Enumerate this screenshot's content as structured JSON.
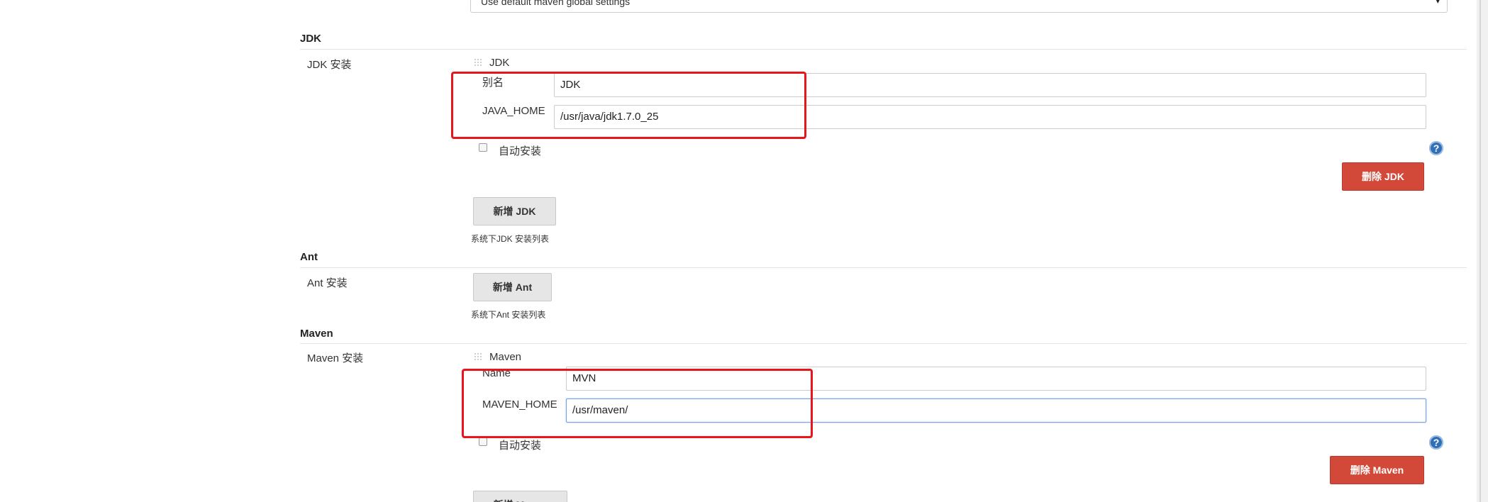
{
  "top_select": {
    "value": "Use default maven global settings"
  },
  "jdk": {
    "section_title": "JDK",
    "row_label": "JDK 安装",
    "item_title": "JDK",
    "alias_label": "别名",
    "alias_value": "JDK",
    "home_label": "JAVA_HOME",
    "home_value": "/usr/java/jdk1.7.0_25",
    "auto_install_label": "自动安装",
    "delete_button": "删除 JDK",
    "add_button": "新增 JDK",
    "hint": "系统下JDK 安装列表"
  },
  "ant": {
    "section_title": "Ant",
    "row_label": "Ant 安装",
    "add_button": "新增 Ant",
    "hint": "系统下Ant 安装列表"
  },
  "maven": {
    "section_title": "Maven",
    "row_label": "Maven 安装",
    "item_title": "Maven",
    "name_label": "Name",
    "name_value": "MVN",
    "home_label": "MAVEN_HOME",
    "home_value": "/usr/maven/",
    "auto_install_label": "自动安装",
    "delete_button": "删除 Maven",
    "add_button": "新增 Maven"
  },
  "icons": {
    "help": "?",
    "caret": "▾"
  },
  "colors": {
    "danger": "#d24939",
    "highlight": "#e8161b",
    "help": "#2f6fb8",
    "focus": "#73a3e6"
  }
}
